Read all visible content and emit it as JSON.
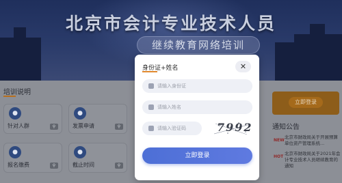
{
  "banner": {
    "title": "北京市会计专业技术人员",
    "subtitle": "继续教育网络培训"
  },
  "sections": {
    "training_title": "培训说明",
    "notice_title": "通知公告"
  },
  "tiles": [
    {
      "label": "针对人群",
      "icon": "users-icon"
    },
    {
      "label": "发票申请",
      "icon": "invoice-icon"
    },
    {
      "label": "报名缴费",
      "icon": "payment-icon"
    },
    {
      "label": "截止时间",
      "icon": "clock-icon"
    }
  ],
  "side": {
    "login_label": "立即登录"
  },
  "notices": [
    {
      "tag": "NEW",
      "text": "北京市财政局关于开展预算单位资产管理系统..."
    },
    {
      "tag": "HOT",
      "text": "北京市财政局关于2021年会计专业技术人员继续教育的通知"
    }
  ],
  "modal": {
    "title": "身份证+姓名",
    "close_symbol": "✕",
    "id_placeholder": "请输入身份证",
    "name_placeholder": "请输入姓名",
    "captcha_placeholder": "请输入验证码",
    "captcha_code": "7992",
    "submit_label": "立即登录"
  },
  "colors": {
    "accent": "#5f7ae0",
    "tab_underline": "#e0882d",
    "banner_bg": "#1f2f5c"
  }
}
